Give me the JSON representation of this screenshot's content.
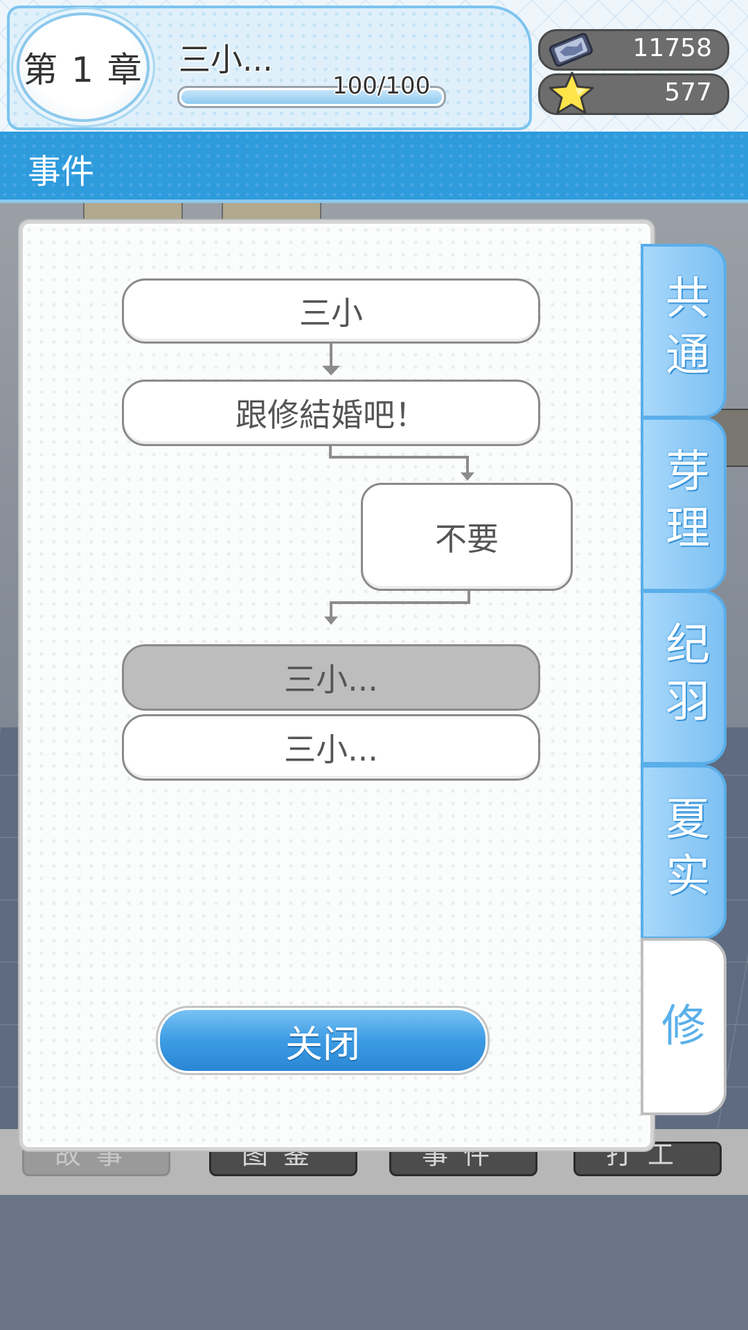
{
  "header": {
    "chapter": "第 1 章",
    "title": "三小...",
    "progress": {
      "current": 100,
      "max": 100,
      "text": "100/100"
    },
    "currency": {
      "value": "11758",
      "icon": "gem-card-icon"
    },
    "stars": {
      "value": "577",
      "icon": "star-icon"
    }
  },
  "section": {
    "title": "事件"
  },
  "flow": {
    "nodes": [
      "三小",
      "跟修結婚吧！"
    ],
    "choice": "不要",
    "options": [
      {
        "label": "三小...",
        "state": "selected"
      },
      {
        "label": "三小...",
        "state": "normal"
      }
    ]
  },
  "close_label": "关闭",
  "tabs": [
    {
      "label": "共通",
      "active": false
    },
    {
      "label": "芽理",
      "active": false
    },
    {
      "label": "纪羽",
      "active": false
    },
    {
      "label": "夏实",
      "active": false
    },
    {
      "label": "修",
      "active": true
    }
  ],
  "bottom_nav": [
    "故事",
    "图鉴",
    "事件",
    "打工"
  ],
  "colors": {
    "accent": "#2e9bdd",
    "tab": "#7cc0f2",
    "node_selected": "#bdbdbd"
  }
}
